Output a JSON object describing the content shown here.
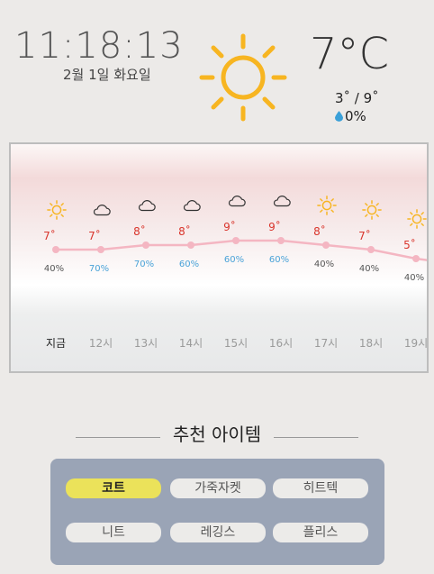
{
  "header": {
    "time": "11:18:13",
    "date": "2월 1일 화요일",
    "current_temp": "7°C",
    "min_max": "3˚ / 9˚",
    "precip": "0%",
    "weather_icon": "sun-icon"
  },
  "forecast": {
    "hours": [
      {
        "label": "지금",
        "temp": "7˚",
        "precip": "40%",
        "icon": "sun-icon",
        "temp_value": 7,
        "precip_color": "#555555"
      },
      {
        "label": "12시",
        "temp": "7˚",
        "precip": "70%",
        "icon": "cloud-icon",
        "temp_value": 7,
        "precip_color": "#4aa3d8"
      },
      {
        "label": "13시",
        "temp": "8˚",
        "precip": "70%",
        "icon": "cloud-icon",
        "temp_value": 8,
        "precip_color": "#4aa3d8"
      },
      {
        "label": "14시",
        "temp": "8˚",
        "precip": "60%",
        "icon": "cloud-icon",
        "temp_value": 8,
        "precip_color": "#4aa3d8"
      },
      {
        "label": "15시",
        "temp": "9˚",
        "precip": "60%",
        "icon": "cloud-icon",
        "temp_value": 9,
        "precip_color": "#4aa3d8"
      },
      {
        "label": "16시",
        "temp": "9˚",
        "precip": "60%",
        "icon": "cloud-icon",
        "temp_value": 9,
        "precip_color": "#4aa3d8"
      },
      {
        "label": "17시",
        "temp": "8˚",
        "precip": "40%",
        "icon": "sun-icon",
        "temp_value": 8,
        "precip_color": "#555555"
      },
      {
        "label": "18시",
        "temp": "7˚",
        "precip": "40%",
        "icon": "sun-icon",
        "temp_value": 7,
        "precip_color": "#555555"
      },
      {
        "label": "19시",
        "temp": "5˚",
        "precip": "40%",
        "icon": "sun-icon",
        "temp_value": 5,
        "precip_color": "#555555"
      }
    ],
    "line_color": "#f4b6c2"
  },
  "recommend": {
    "title": "추천 아이템",
    "items": [
      {
        "label": "코트",
        "selected": true
      },
      {
        "label": "가죽자켓",
        "selected": false
      },
      {
        "label": "히트텍",
        "selected": false
      },
      {
        "label": "니트",
        "selected": false
      },
      {
        "label": "레깅스",
        "selected": false
      },
      {
        "label": "플리스",
        "selected": false
      }
    ]
  }
}
